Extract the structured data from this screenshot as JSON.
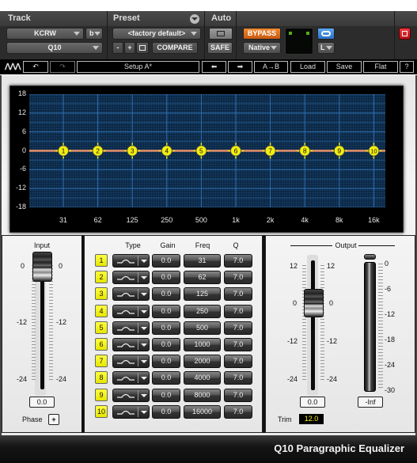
{
  "header": {
    "track": {
      "title": "Track",
      "track_name": "KCRW",
      "channel": "b",
      "insert": "Q10"
    },
    "preset": {
      "title": "Preset",
      "current": "<factory default>",
      "minus_label": "-",
      "plus_label": "+",
      "compare_label": "COMPARE"
    },
    "auto": {
      "title": "Auto",
      "safe_label": "SAFE"
    },
    "bypass_label": "BYPASS",
    "processing_mode": "Native",
    "channel_select": "L",
    "colors": {
      "bypass": "#e07020",
      "link": "#3a8ee0",
      "close": "#d81e2a"
    }
  },
  "toolbar": {
    "undo_icon": "undo-icon",
    "redo_icon": "redo-icon",
    "setup_label": "Setup A*",
    "prev_label": "⬅",
    "next_label": "➡",
    "ab_label": "A→B",
    "load_label": "Load",
    "save_label": "Save",
    "flat_label": "Flat",
    "help_label": "?"
  },
  "graph": {
    "y_labels": [
      "18",
      "12",
      "6",
      "0",
      "-6",
      "-12",
      "-18"
    ],
    "x_labels": [
      "31",
      "62",
      "125",
      "250",
      "500",
      "1k",
      "2k",
      "4k",
      "8k",
      "16k"
    ],
    "bands": [
      {
        "num": "1",
        "gain": 0
      },
      {
        "num": "2",
        "gain": 0
      },
      {
        "num": "3",
        "gain": 0
      },
      {
        "num": "4",
        "gain": 0
      },
      {
        "num": "5",
        "gain": 0
      },
      {
        "num": "6",
        "gain": 0
      },
      {
        "num": "7",
        "gain": 0
      },
      {
        "num": "8",
        "gain": 0
      },
      {
        "num": "9",
        "gain": 0
      },
      {
        "num": "10",
        "gain": 0
      }
    ],
    "curve_color": "#e8906a",
    "band_color": "#f2ee10"
  },
  "input": {
    "title": "Input",
    "scale": [
      "0",
      "-12",
      "-24"
    ],
    "value": "0.0",
    "phase_label": "Phase",
    "phase_symbol": "+"
  },
  "table": {
    "headers": {
      "type": "Type",
      "gain": "Gain",
      "freq": "Freq",
      "q": "Q"
    },
    "rows": [
      {
        "band": "1",
        "gain": "0.0",
        "freq": "31",
        "q": "7.0"
      },
      {
        "band": "2",
        "gain": "0.0",
        "freq": "62",
        "q": "7.0"
      },
      {
        "band": "3",
        "gain": "0.0",
        "freq": "125",
        "q": "7.0"
      },
      {
        "band": "4",
        "gain": "0.0",
        "freq": "250",
        "q": "7.0"
      },
      {
        "band": "5",
        "gain": "0.0",
        "freq": "500",
        "q": "7.0"
      },
      {
        "band": "6",
        "gain": "0.0",
        "freq": "1000",
        "q": "7.0"
      },
      {
        "band": "7",
        "gain": "0.0",
        "freq": "2000",
        "q": "7.0"
      },
      {
        "band": "8",
        "gain": "0.0",
        "freq": "4000",
        "q": "7.0"
      },
      {
        "band": "9",
        "gain": "0.0",
        "freq": "8000",
        "q": "7.0"
      },
      {
        "band": "10",
        "gain": "0.0",
        "freq": "16000",
        "q": "7.0"
      }
    ]
  },
  "output": {
    "title": "Output",
    "fader_scale": [
      "12",
      "0",
      "-12",
      "-24"
    ],
    "fader_value": "0.0",
    "meter_scale": [
      "0",
      "-6",
      "-12",
      "-18",
      "-24",
      "-30"
    ],
    "meter_value": "-Inf",
    "trim_label": "Trim",
    "trim_value": "12.0"
  },
  "footer": {
    "title": "Q10 Paragraphic Equalizer"
  }
}
